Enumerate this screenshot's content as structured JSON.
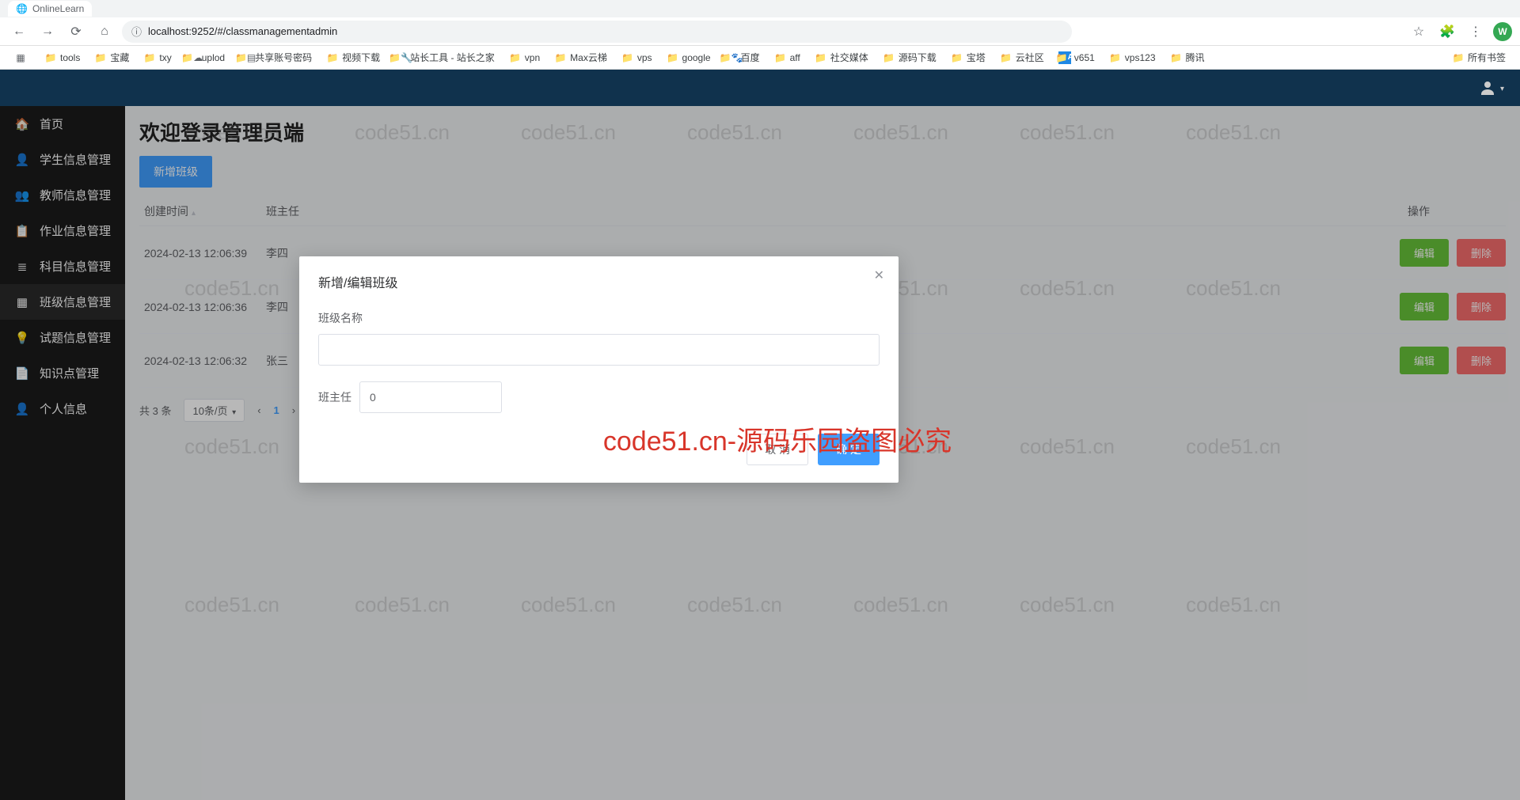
{
  "browser": {
    "tab_title": "OnlineLearn",
    "url": "localhost:9252/#/classmanagementadmin",
    "avatar_initial": "W",
    "bookmarks": [
      {
        "label": "",
        "icon": "grid"
      },
      {
        "label": "tools",
        "icon": "folder"
      },
      {
        "label": "宝藏",
        "icon": "folder"
      },
      {
        "label": "txy",
        "icon": "folder"
      },
      {
        "label": "uplod",
        "icon": "cloud"
      },
      {
        "label": "共享账号密码",
        "icon": "sheet"
      },
      {
        "label": "视频下载",
        "icon": "folder"
      },
      {
        "label": "站长工具 - 站长之家",
        "icon": "site"
      },
      {
        "label": "vpn",
        "icon": "folder"
      },
      {
        "label": "Max云梯",
        "icon": "folder"
      },
      {
        "label": "vps",
        "icon": "folder"
      },
      {
        "label": "google",
        "icon": "folder"
      },
      {
        "label": "百度",
        "icon": "paw"
      },
      {
        "label": "aff",
        "icon": "folder"
      },
      {
        "label": "社交媒体",
        "icon": "folder"
      },
      {
        "label": "源码下载",
        "icon": "folder"
      },
      {
        "label": "宝塔",
        "icon": "folder"
      },
      {
        "label": "云社区",
        "icon": "folder"
      },
      {
        "label": "v651",
        "icon": "A"
      },
      {
        "label": "vps123",
        "icon": "folder"
      },
      {
        "label": "腾讯",
        "icon": "folder"
      }
    ],
    "bookmarks_right": {
      "label": "所有书签",
      "icon": "folder"
    }
  },
  "sidebar": {
    "items": [
      {
        "label": "首页",
        "icon": "home"
      },
      {
        "label": "学生信息管理",
        "icon": "user"
      },
      {
        "label": "教师信息管理",
        "icon": "users"
      },
      {
        "label": "作业信息管理",
        "icon": "clipboard"
      },
      {
        "label": "科目信息管理",
        "icon": "list"
      },
      {
        "label": "班级信息管理",
        "icon": "grid",
        "active": true
      },
      {
        "label": "试题信息管理",
        "icon": "bulb"
      },
      {
        "label": "知识点管理",
        "icon": "note"
      },
      {
        "label": "个人信息",
        "icon": "person"
      }
    ]
  },
  "main": {
    "title": "欢迎登录管理员端",
    "add_button": "新增班级",
    "columns": {
      "time": "创建时间",
      "teacher": "班主任",
      "actions": "操作"
    },
    "rows": [
      {
        "time": "2024-02-13 12:06:39",
        "teacher": "李四"
      },
      {
        "time": "2024-02-13 12:06:36",
        "teacher": "李四"
      },
      {
        "time": "2024-02-13 12:06:32",
        "teacher": "张三"
      }
    ],
    "row_edit": "编辑",
    "row_delete": "删除",
    "pager": {
      "total": "共 3 条",
      "per_page": "10条/页",
      "page": "1"
    }
  },
  "modal": {
    "title": "新增/编辑班级",
    "field_name_label": "班级名称",
    "field_teacher_label": "班主任",
    "field_teacher_value": "0",
    "cancel": "取 消",
    "confirm": "确 定"
  },
  "watermark": {
    "text": "code51.cn",
    "red": "code51.cn-源码乐园盗图必究"
  }
}
